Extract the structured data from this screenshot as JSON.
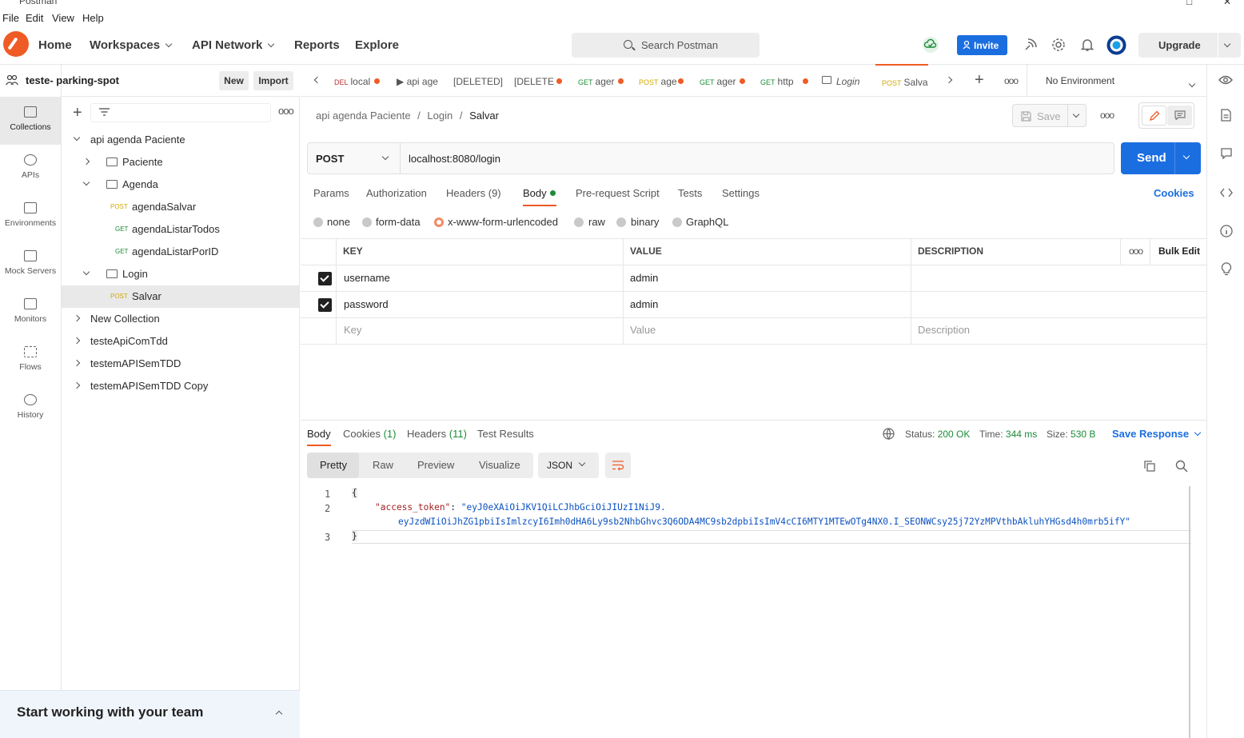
{
  "window": {
    "title": "Postman"
  },
  "menu": [
    "File",
    "Edit",
    "View",
    "Help"
  ],
  "header": {
    "nav": [
      "Home",
      "Workspaces",
      "API Network",
      "Reports",
      "Explore"
    ],
    "search_placeholder": "Search Postman",
    "invite_label": "Invite",
    "upgrade_label": "Upgrade"
  },
  "workspace": {
    "name": "teste- parking-spot",
    "new_label": "New",
    "import_label": "Import"
  },
  "rail": [
    "Collections",
    "APIs",
    "Environments",
    "Mock Servers",
    "Monitors",
    "Flows",
    "History"
  ],
  "tree": [
    {
      "label": "api agenda Paciente"
    },
    {
      "label": "Paciente"
    },
    {
      "label": "Agenda"
    },
    {
      "method": "POST",
      "label": "agendaSalvar"
    },
    {
      "method": "GET",
      "label": "agendaListarTodos"
    },
    {
      "method": "GET",
      "label": "agendaListarPorID"
    },
    {
      "label": "Login"
    },
    {
      "method": "POST",
      "label": "Salvar"
    },
    {
      "label": "New Collection"
    },
    {
      "label": "testeApiComTdd"
    },
    {
      "label": "testemAPISemTDD"
    },
    {
      "label": "testemAPISemTDD Copy"
    }
  ],
  "team_banner": "Start working with your team",
  "tabs": [
    {
      "method": "DEL",
      "label": "local"
    },
    {
      "method": "",
      "label": "api age"
    },
    {
      "method": "",
      "label": "[DELETED]"
    },
    {
      "method": "",
      "label": "[DELETE"
    },
    {
      "method": "GET",
      "label": "ager"
    },
    {
      "method": "POST",
      "label": "age"
    },
    {
      "method": "GET",
      "label": "ager"
    },
    {
      "method": "GET",
      "label": "http"
    },
    {
      "method": "",
      "label": "Login"
    },
    {
      "method": "POST",
      "label": "Salva"
    }
  ],
  "environment": "No Environment",
  "breadcrumb": {
    "collection": "api agenda Paciente",
    "folder": "Login",
    "request": "Salvar"
  },
  "save_label": "Save",
  "request": {
    "method": "POST",
    "url": "localhost:8080/login",
    "send_label": "Send"
  },
  "request_tabs": [
    "Params",
    "Authorization",
    "Headers (9)",
    "Body",
    "Pre-request Script",
    "Tests",
    "Settings"
  ],
  "cookies_label": "Cookies",
  "body_modes": [
    "none",
    "form-data",
    "x-www-form-urlencoded",
    "raw",
    "binary",
    "GraphQL"
  ],
  "kv": {
    "headers": [
      "KEY",
      "VALUE",
      "DESCRIPTION"
    ],
    "bulk_edit": "Bulk Edit",
    "rows": [
      {
        "key": "username",
        "value": "admin"
      },
      {
        "key": "password",
        "value": "admin"
      }
    ],
    "placeholders": {
      "key": "Key",
      "value": "Value",
      "description": "Description"
    }
  },
  "response": {
    "tabs": {
      "body": "Body",
      "cookies": "Cookies",
      "cookies_count": "(1)",
      "headers": "Headers",
      "headers_count": "(11)",
      "tests": "Test Results"
    },
    "status_label": "Status:",
    "status": "200 OK",
    "time_label": "Time:",
    "time": "344 ms",
    "size_label": "Size:",
    "size": "530 B",
    "save_response": "Save Response",
    "views": [
      "Pretty",
      "Raw",
      "Preview",
      "Visualize"
    ],
    "format": "JSON",
    "lines": [
      "1",
      "2",
      "3"
    ],
    "open_brace": "{",
    "close_brace": "}",
    "token_key": "\"access_token\"",
    "token_value_1": "\"eyJ0eXAiOiJKV1QiLCJhbGciOiJIUzI1NiJ9.",
    "token_value_2": "eyJzdWIiOiJhZG1pbiIsImlzcyI6Imh0dHA6Ly9sb2NhbGhvc3Q6ODA4MC9sb2dpbiIsImV4cCI6MTY1MTEwOTg4NX0.I_SEONWCsy25j72YzMPVthbAkluhYHGsd4h0mrb5ifY\""
  },
  "colors": {
    "accent": "#ef5b25",
    "primary": "#1b6ee0",
    "success": "#1b8c38"
  }
}
